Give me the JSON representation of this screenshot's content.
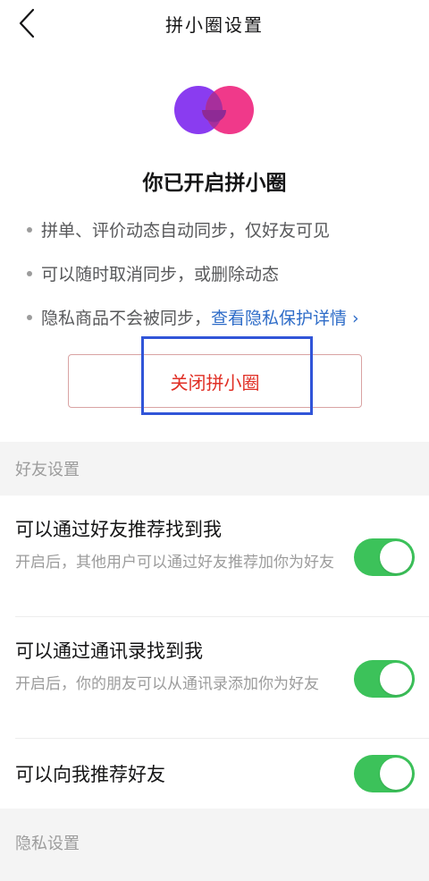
{
  "header": {
    "title": "拼小圈设置"
  },
  "hero": {
    "title": "你已开启拼小圈"
  },
  "bullets": [
    {
      "text": "拼单、评价动态自动同步，仅好友可见"
    },
    {
      "text": "可以随时取消同步，或删除动态"
    },
    {
      "text": "隐私商品不会被同步，",
      "link": "查看隐私保护详情 ›"
    }
  ],
  "close_button": {
    "label": "关闭拼小圈"
  },
  "friend_section": {
    "title": "好友设置",
    "items": [
      {
        "title": "可以通过好友推荐找到我",
        "desc": "开启后，其他用户可以通过好友推荐加你为好友",
        "enabled": true
      },
      {
        "title": "可以通过通讯录找到我",
        "desc": "开启后，你的朋友可以从通讯录添加你为好友",
        "enabled": true
      },
      {
        "title": "可以向我推荐好友",
        "enabled": true
      }
    ]
  },
  "privacy_section": {
    "title": "隐私设置"
  },
  "colors": {
    "accent_red": "#e02e24",
    "link_blue": "#2e6cc8",
    "toggle_green": "#3cc25a",
    "logo_purple": "#8a3cf0",
    "logo_pink": "#f0398a",
    "highlight_blue": "#3155d8"
  },
  "icons": {
    "back": "chevron-left-icon",
    "logo": "pinxiaoquan-logo"
  }
}
